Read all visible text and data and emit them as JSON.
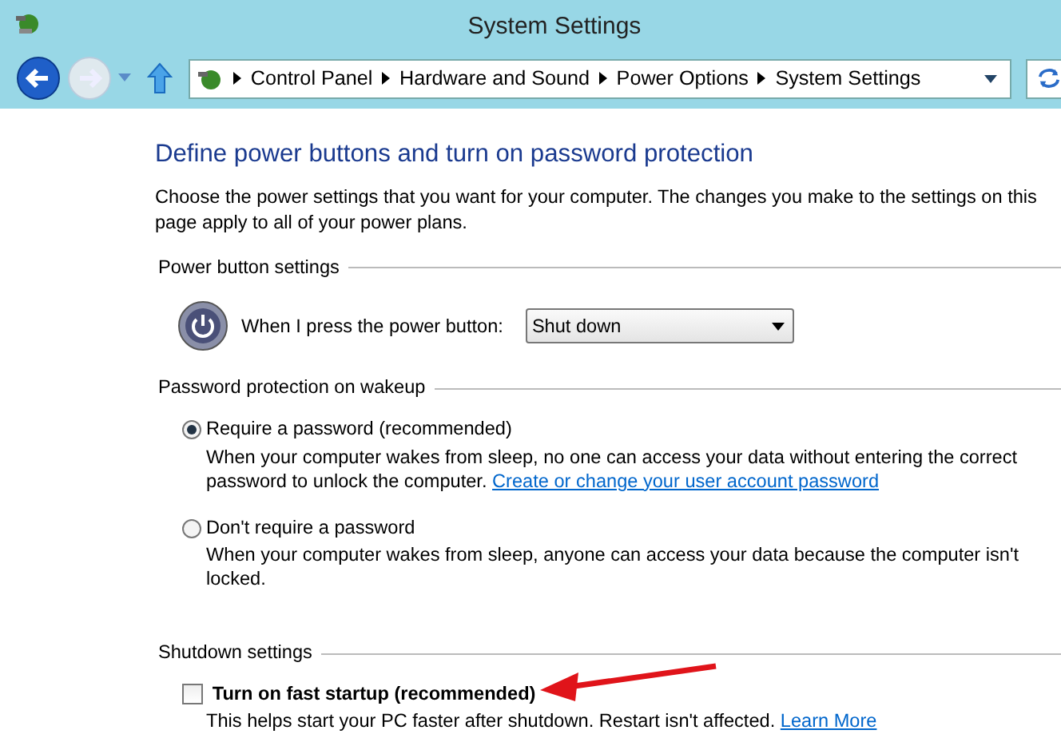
{
  "window": {
    "title": "System Settings"
  },
  "address_bar": {
    "breadcrumbs": [
      "Control Panel",
      "Hardware and Sound",
      "Power Options",
      "System Settings"
    ]
  },
  "heading": "Define power buttons and turn on password protection",
  "description": "Choose the power settings that you want for your computer. The changes you make to the settings on this page apply to all of your power plans.",
  "power_button": {
    "title": "Power button settings",
    "label": "When I press the power button:",
    "value": "Shut down"
  },
  "password": {
    "title": "Password protection on wakeup",
    "options": [
      {
        "label": "Require a password (recommended)",
        "selected": true,
        "description": "When your computer wakes from sleep, no one can access your data without entering the correct password to unlock the computer.",
        "link": "Create or change your user account password"
      },
      {
        "label": "Don't require a password",
        "selected": false,
        "description": "When your computer wakes from sleep, anyone can access your data because the computer isn't locked."
      }
    ]
  },
  "shutdown": {
    "title": "Shutdown settings",
    "items": [
      {
        "label": "Turn on fast startup (recommended)",
        "checked": false,
        "description": "This helps start your PC faster after shutdown. Restart isn't affected.",
        "link": "Learn More"
      }
    ]
  }
}
